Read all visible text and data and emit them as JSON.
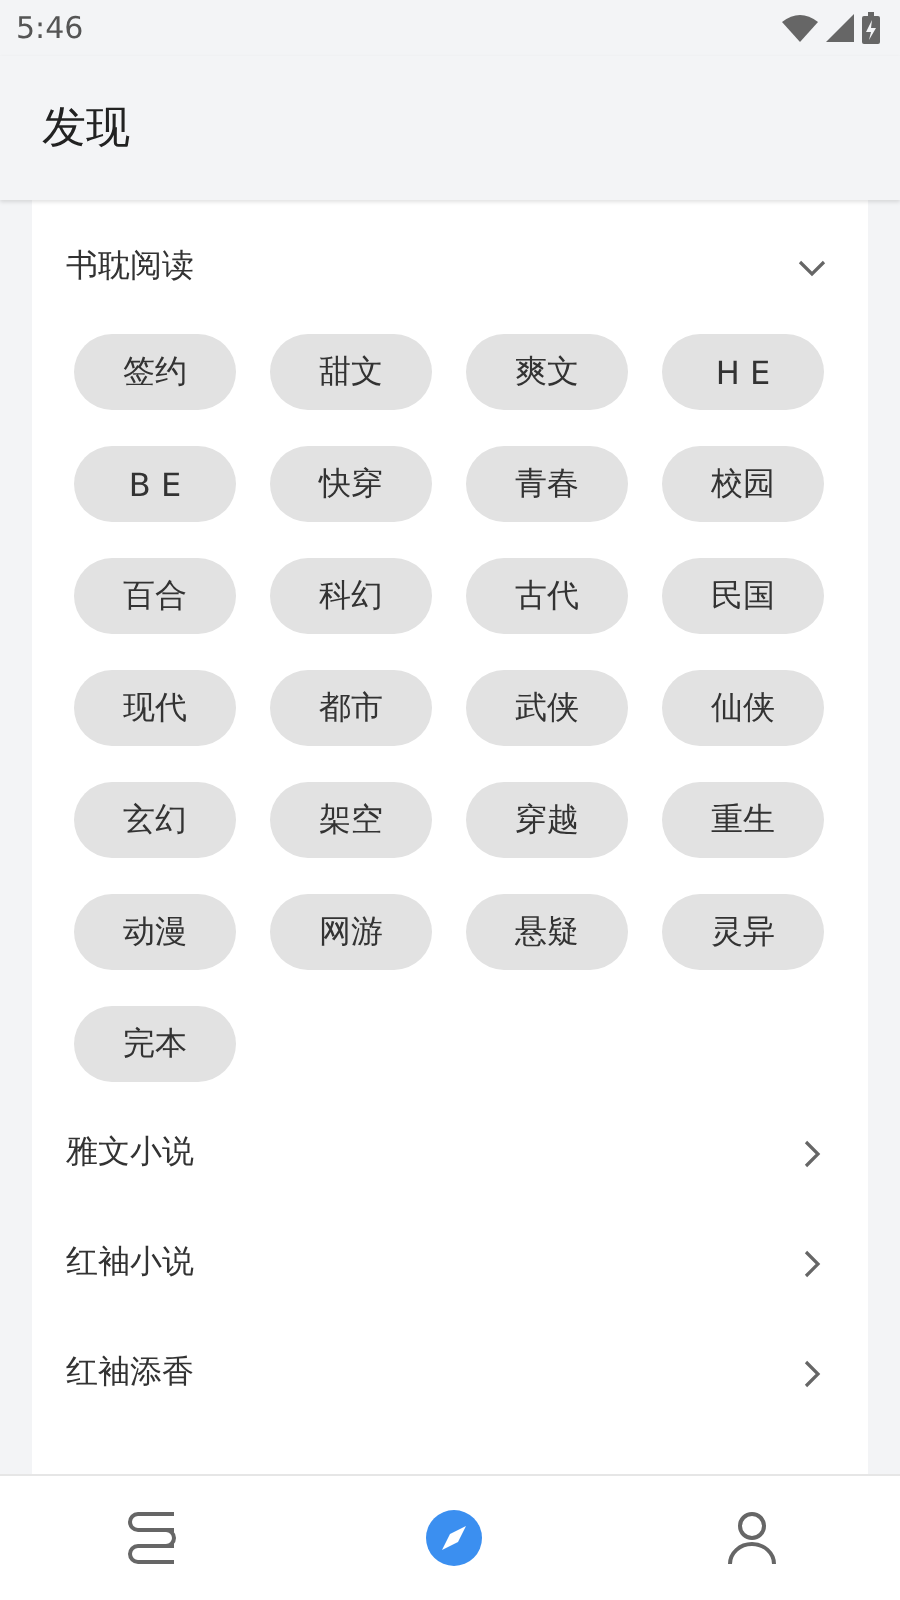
{
  "status_bar": {
    "time": "5:46"
  },
  "app_bar": {
    "title": "发现"
  },
  "sections": [
    {
      "title": "书耽阅读",
      "expanded": true,
      "tags": [
        "签约",
        "甜文",
        "爽文",
        "H E",
        "B E",
        "快穿",
        "青春",
        "校园",
        "百合",
        "科幻",
        "古代",
        "民国",
        "现代",
        "都市",
        "武侠",
        "仙侠",
        "玄幻",
        "架空",
        "穿越",
        "重生",
        "动漫",
        "网游",
        "悬疑",
        "灵异",
        "完本"
      ]
    },
    {
      "title": "雅文小说",
      "expanded": false
    },
    {
      "title": "红袖小说",
      "expanded": false
    },
    {
      "title": "红袖添香",
      "expanded": false
    }
  ],
  "bottom_nav": [
    {
      "kind": "bookshelf",
      "selected": false
    },
    {
      "kind": "discover",
      "selected": true
    },
    {
      "kind": "profile",
      "selected": false
    }
  ]
}
